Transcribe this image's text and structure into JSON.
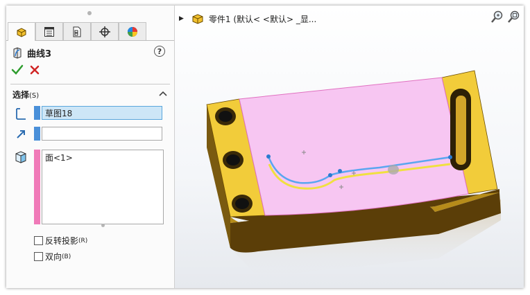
{
  "property_manager": {
    "feature_title": "曲线3",
    "help_label": "?",
    "section": {
      "title": "选择",
      "hotkey": "(S)"
    },
    "sketch_field": "草图18",
    "direction_field": "",
    "faces_list": [
      "面<1>"
    ],
    "reverse_projection": {
      "label": "反转投影",
      "hotkey": "(R)",
      "checked": false
    },
    "bidirectional": {
      "label": "双向",
      "hotkey": "(B)",
      "checked": false
    }
  },
  "graphics": {
    "breadcrumb": "零件1   (默认< <默认> _显..."
  },
  "colors": {
    "selection_blue": "#4a90d9",
    "selection_pink": "#f07ab8",
    "part_yellow": "#f2cc3a",
    "face_pink": "#f7c6f2",
    "curve_blue": "#5aa6f0",
    "curve_yellow": "#f0e040"
  },
  "icons": [
    "part-tab-icon",
    "property-tab-icon",
    "config-tab-icon",
    "origin-tab-icon",
    "appearance-tab-icon",
    "curve-icon",
    "help-icon",
    "ok-check-icon",
    "cancel-x-icon",
    "sketch-edge-icon",
    "direction-arrow-icon",
    "face-icon",
    "part-icon",
    "zoom-fit-icon",
    "zoom-area-icon"
  ]
}
